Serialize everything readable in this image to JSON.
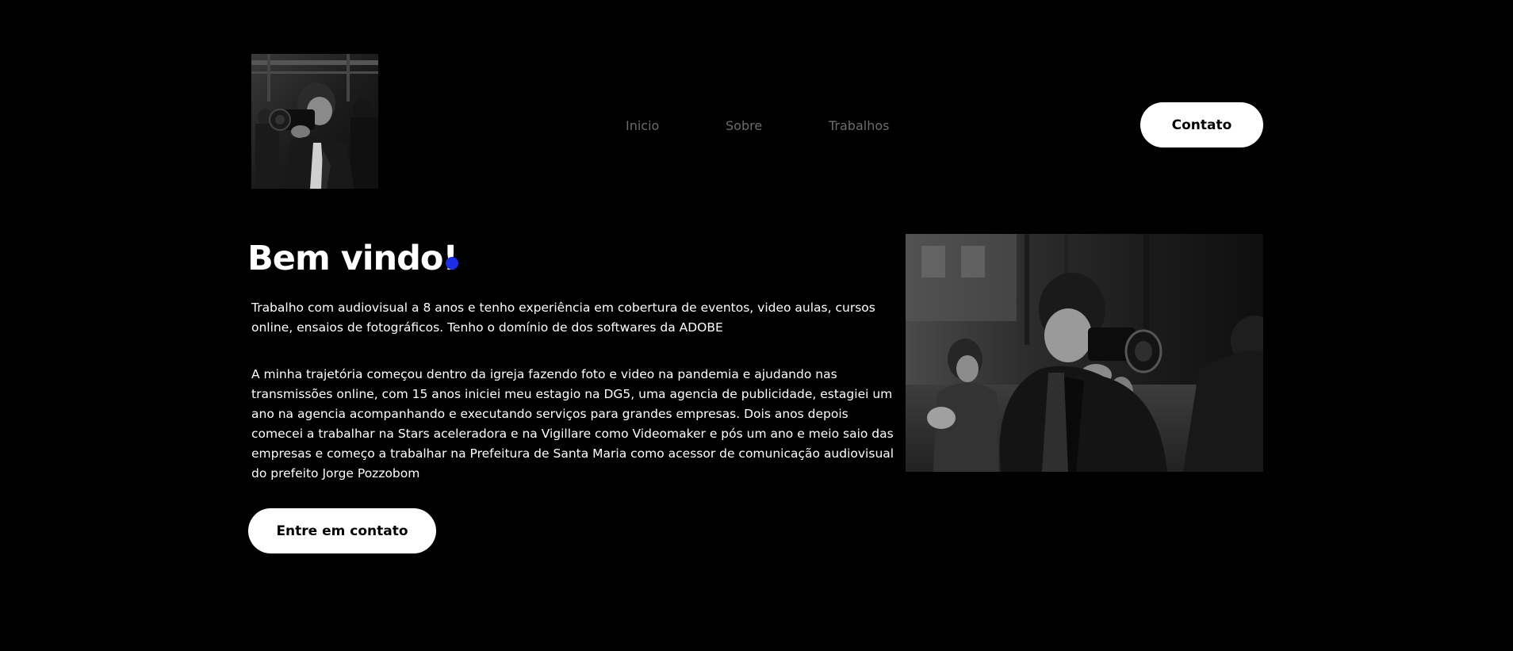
{
  "header": {
    "logo_alt": "photographer-logo",
    "nav": [
      {
        "label": "Inicio"
      },
      {
        "label": "Sobre"
      },
      {
        "label": "Trabalhos"
      }
    ],
    "contact_label": "Contato"
  },
  "hero": {
    "title": "Bem vindo!",
    "accent_color": "#1a2ee8",
    "paragraph_1": "Trabalho com audiovisual a 8 anos e tenho experiência em cobertura de eventos, video aulas, cursos online, ensaios de fotográficos. Tenho o domínio de dos softwares da ADOBE",
    "paragraph_2": "A minha trajetória começou dentro da igreja fazendo foto e video na pandemia e ajudando nas transmissões online, com 15 anos iniciei meu estagio na DG5, uma agencia de publicidade, estagiei um ano na agencia acompanhando e executando serviços para grandes empresas. Dois anos depois comecei a trabalhar na Stars aceleradora e na Vigillare como Videomaker e pós um ano e meio saio das empresas e começo a trabalhar na Prefeitura de Santa Maria como acessor de comunicação audiovisual do prefeito Jorge Pozzobom",
    "cta_label": "Entre em contato"
  },
  "theme": {
    "background": "#000000",
    "text": "#ffffff",
    "nav_text": "#6b6b6b",
    "button_bg": "#ffffff",
    "button_text": "#000000"
  }
}
